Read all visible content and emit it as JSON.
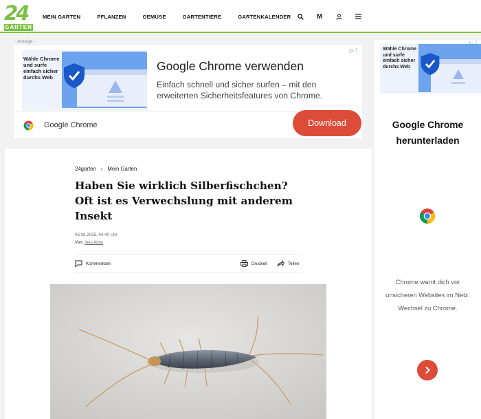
{
  "brand": {
    "logo_number": "24",
    "logo_word": "GARTEN"
  },
  "nav": [
    "MEIN GARTEN",
    "PFLANZEN",
    "GEMÜSE",
    "GARTENTIERE",
    "GARTENKALENDER"
  ],
  "header_icons": {
    "search": "search-icon",
    "mail": "M",
    "user": "user-icon",
    "menu": "menu-icon"
  },
  "ad_banner": {
    "label": "- Anzeige -",
    "thumb_text": "Wähle Chrome und surfe einfach sicher durchs Web",
    "title": "Google Chrome verwenden",
    "description": "Einfach schnell und sicher surfen – mit den erweiterten Sicherheitsfeatures von Chrome.",
    "brand": "Google Chrome",
    "button": "Download"
  },
  "article": {
    "breadcrumb": [
      "24garten",
      "Mein Garten"
    ],
    "breadcrumb_sep": "›",
    "headline": "Haben Sie wirklich Silberfischchen? Oft ist es Verwechslung mit anderem Insekt",
    "date": "05.08.2025, 04:40 Uhr",
    "author_prefix": "Von:",
    "author": "Ines Alms",
    "comments": "Kommentare",
    "print": "Drucken",
    "share": "Teilen"
  },
  "side_ad": {
    "thumb_text": "Wähle Chrome und surfe einfach sicher durchs Web",
    "title": "Google Chrome herunterladen",
    "description": "Chrome warnt dich vor unsicheren Websites im Netz. Wechsel zu Chrome."
  },
  "colors": {
    "brand_green": "#7ac143",
    "cta_red": "#dd4b39",
    "ad_blue": "#6da3ec"
  }
}
